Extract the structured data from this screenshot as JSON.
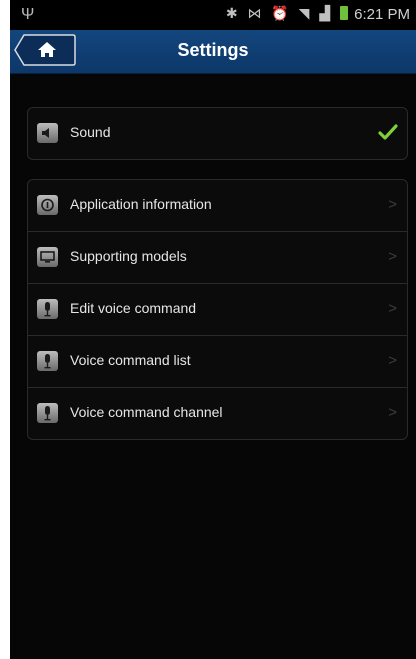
{
  "status_bar": {
    "usb_icon": "usb-icon",
    "icons": [
      "bluetooth-icon",
      "vibrate-icon",
      "alarm-icon",
      "wifi-icon",
      "signal-icon",
      "battery-charging-icon"
    ],
    "time": "6:21 PM"
  },
  "header": {
    "title": "Settings",
    "home_icon": "home-icon"
  },
  "groups": [
    {
      "items": [
        {
          "label": "Sound",
          "icon": "speaker-icon",
          "control": "checkmark",
          "checked": true
        }
      ]
    },
    {
      "items": [
        {
          "label": "Application information",
          "icon": "info-icon",
          "control": "chevron"
        },
        {
          "label": "Supporting models",
          "icon": "tv-icon",
          "control": "chevron"
        },
        {
          "label": "Edit voice command",
          "icon": "microphone-icon",
          "control": "chevron"
        },
        {
          "label": "Voice command list",
          "icon": "microphone-icon",
          "control": "chevron"
        },
        {
          "label": "Voice command channel",
          "icon": "microphone-icon",
          "control": "chevron"
        }
      ]
    }
  ],
  "colors": {
    "titlebar": "#13467e",
    "background": "#060606",
    "check": "#7ed13a"
  }
}
